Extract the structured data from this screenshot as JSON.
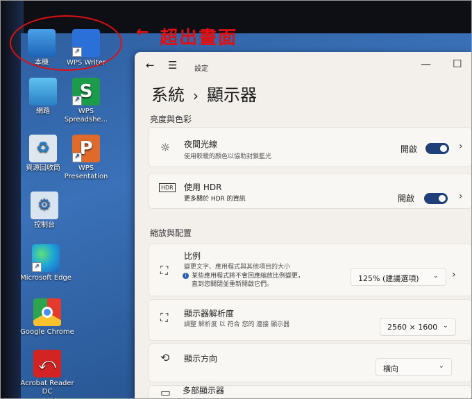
{
  "annotation": {
    "arrow": "←",
    "text": "超出畫面"
  },
  "desktop_icons": [
    {
      "label": "本機",
      "icon": "this-pc-icon"
    },
    {
      "label": "WPS Writer",
      "icon": "wps-writer-icon"
    },
    {
      "label": "網路",
      "icon": "network-icon"
    },
    {
      "label": "WPS Spreadshe...",
      "icon": "wps-spreadsheet-icon",
      "glyph": "S"
    },
    {
      "label": "資源回收筒",
      "icon": "recycle-bin-icon",
      "glyph": "♻"
    },
    {
      "label": "WPS Presentation",
      "icon": "wps-presentation-icon",
      "glyph": "P"
    },
    {
      "label": "控制台",
      "icon": "control-panel-icon",
      "glyph": "⚙"
    },
    {
      "label": "Microsoft Edge",
      "icon": "edge-icon"
    },
    {
      "label": "Google Chrome",
      "icon": "chrome-icon"
    },
    {
      "label": "Acrobat Reader DC",
      "icon": "acrobat-icon",
      "glyph": "⤺"
    }
  ],
  "window": {
    "back": "←",
    "menu": "☰",
    "app_title": "設定",
    "minimize": "—",
    "maximize": "☐",
    "breadcrumb": {
      "parent": "系統",
      "separator": "›",
      "current": "顯示器"
    }
  },
  "brightness": {
    "header": "亮度與色彩",
    "night_light": {
      "icon": "☼",
      "title": "夜間光線",
      "subtitle": "使用較暖的顏色以協助封鎖藍光",
      "state": "開啟",
      "chevron": "›"
    },
    "hdr": {
      "icon": "HDR",
      "title": "使用 HDR",
      "subtitle": "更多關於 HDR 的資訊",
      "state": "開啟",
      "chevron": "›"
    }
  },
  "scale_layout": {
    "header": "縮放與配置",
    "scale": {
      "icon": "⛶",
      "title": "比例",
      "subtitle": "變更文字、應用程式與其他項目的大小",
      "note_line1": "某些應用程式將不會回應縮放比例變更，",
      "note_line2": "直到您關閉並重新開啟它們。",
      "value": "125% (建議選項)",
      "dd_chevron": "⌄",
      "chevron": "›"
    },
    "resolution": {
      "icon": "⛶",
      "title": "顯示器解析度",
      "subtitle": "調整 解析度 以 符合 您的 連接 顯示器",
      "value": "2560 × 1600",
      "dd_chevron": "⌄"
    },
    "orientation": {
      "icon": "⟲",
      "title": "顯示方向",
      "value": "橫向",
      "dd_chevron": "⌄"
    },
    "multi": {
      "icon": "▭",
      "title": "多部顯示器"
    }
  },
  "colors": {
    "accent": "#1d3f7a",
    "annotation": "#e01010",
    "window_bg": "#f3f0ec"
  }
}
